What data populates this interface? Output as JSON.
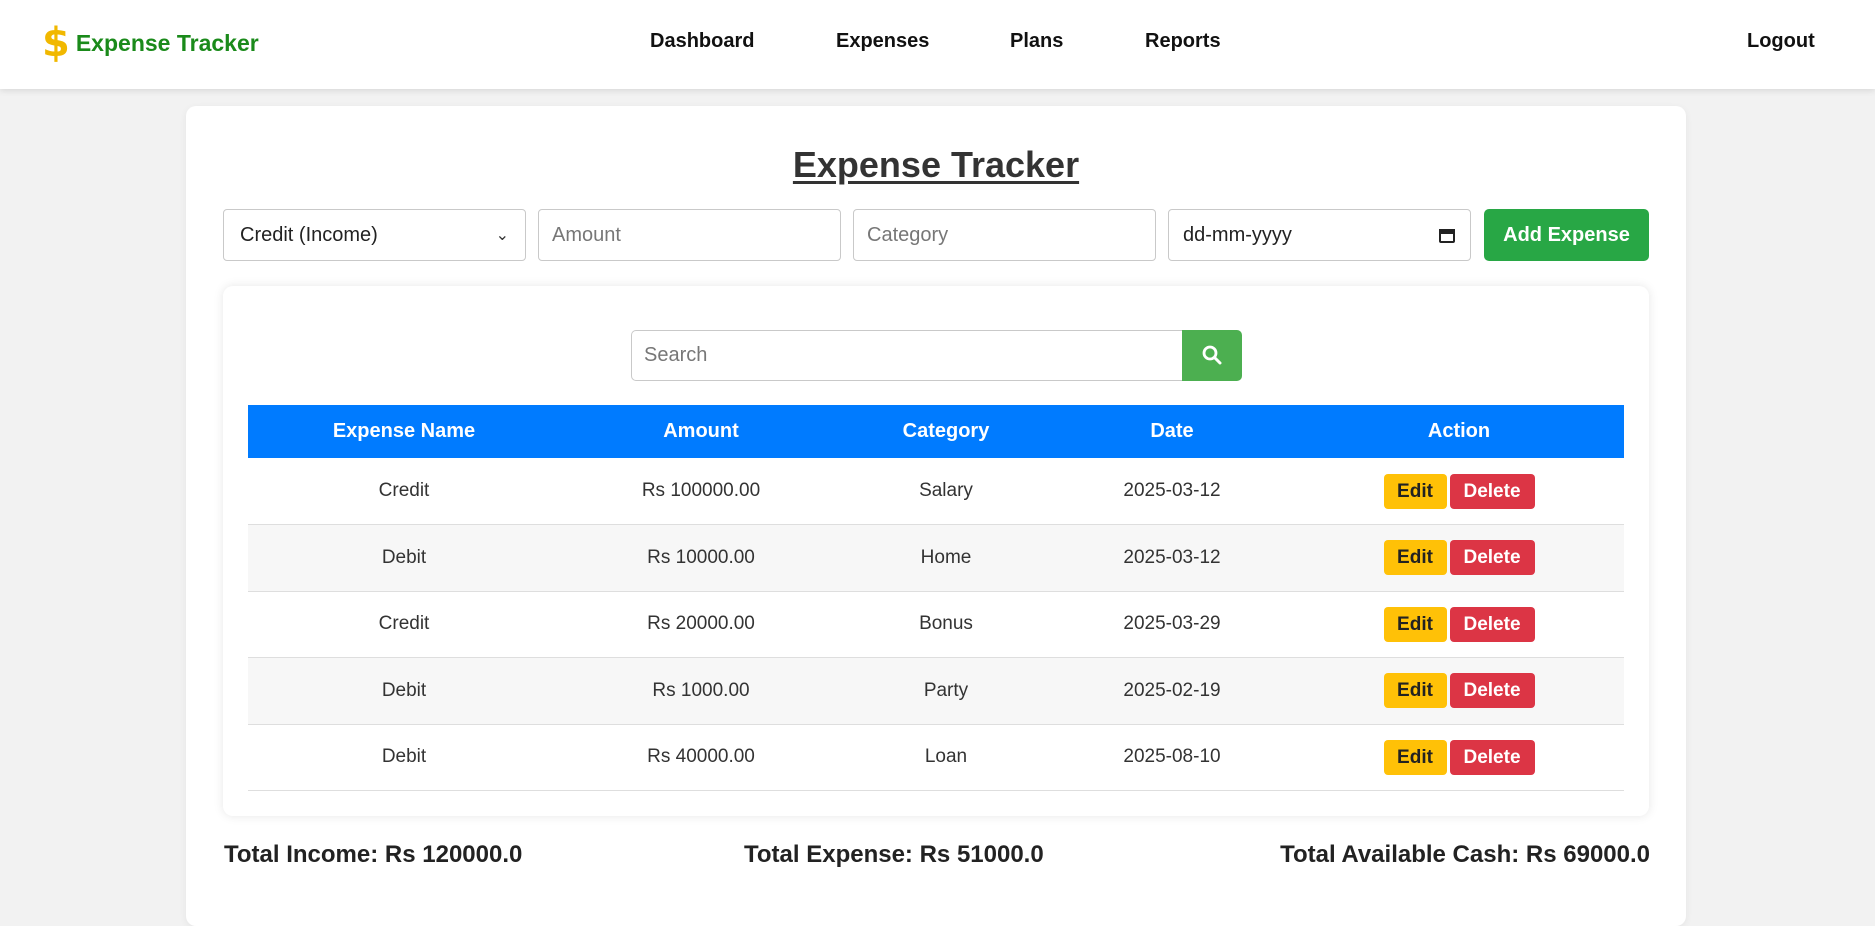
{
  "navbar": {
    "brand_icon": "dollar-sign-icon",
    "brand_label": "Expense Tracker",
    "links": [
      "Dashboard",
      "Expenses",
      "Plans",
      "Reports"
    ],
    "logout_label": "Logout"
  },
  "main": {
    "title": "Expense Tracker",
    "form": {
      "type_value": "Credit (Income)",
      "amount_placeholder": "Amount",
      "category_placeholder": "Category",
      "date_value": "dd-mm-yyyy",
      "add_label": "Add Expense"
    },
    "search": {
      "placeholder": "Search",
      "icon": "search-icon"
    },
    "table": {
      "headers": [
        "Expense Name",
        "Amount",
        "Category",
        "Date",
        "Action"
      ],
      "rows": [
        {
          "name": "Credit",
          "amount": "Rs 100000.00",
          "category": "Salary",
          "date": "2025-03-12"
        },
        {
          "name": "Debit",
          "amount": "Rs 10000.00",
          "category": "Home",
          "date": "2025-03-12"
        },
        {
          "name": "Credit",
          "amount": "Rs 20000.00",
          "category": "Bonus",
          "date": "2025-03-29"
        },
        {
          "name": "Debit",
          "amount": "Rs 1000.00",
          "category": "Party",
          "date": "2025-02-19"
        },
        {
          "name": "Debit",
          "amount": "Rs 40000.00",
          "category": "Loan",
          "date": "2025-08-10"
        }
      ],
      "edit_label": "Edit",
      "delete_label": "Delete"
    },
    "totals": {
      "income": "Total Income: Rs 120000.0",
      "expense": "Total Expense: Rs 51000.0",
      "cash": "Total Available Cash: Rs 69000.0"
    }
  },
  "colors": {
    "brand_green": "#1a8a1a",
    "brand_icon_yellow": "#f1b800",
    "header_blue": "#007bff",
    "add_green": "#28a745",
    "search_green": "#4caf50",
    "edit_yellow": "#ffc107",
    "delete_red": "#dc3545"
  }
}
